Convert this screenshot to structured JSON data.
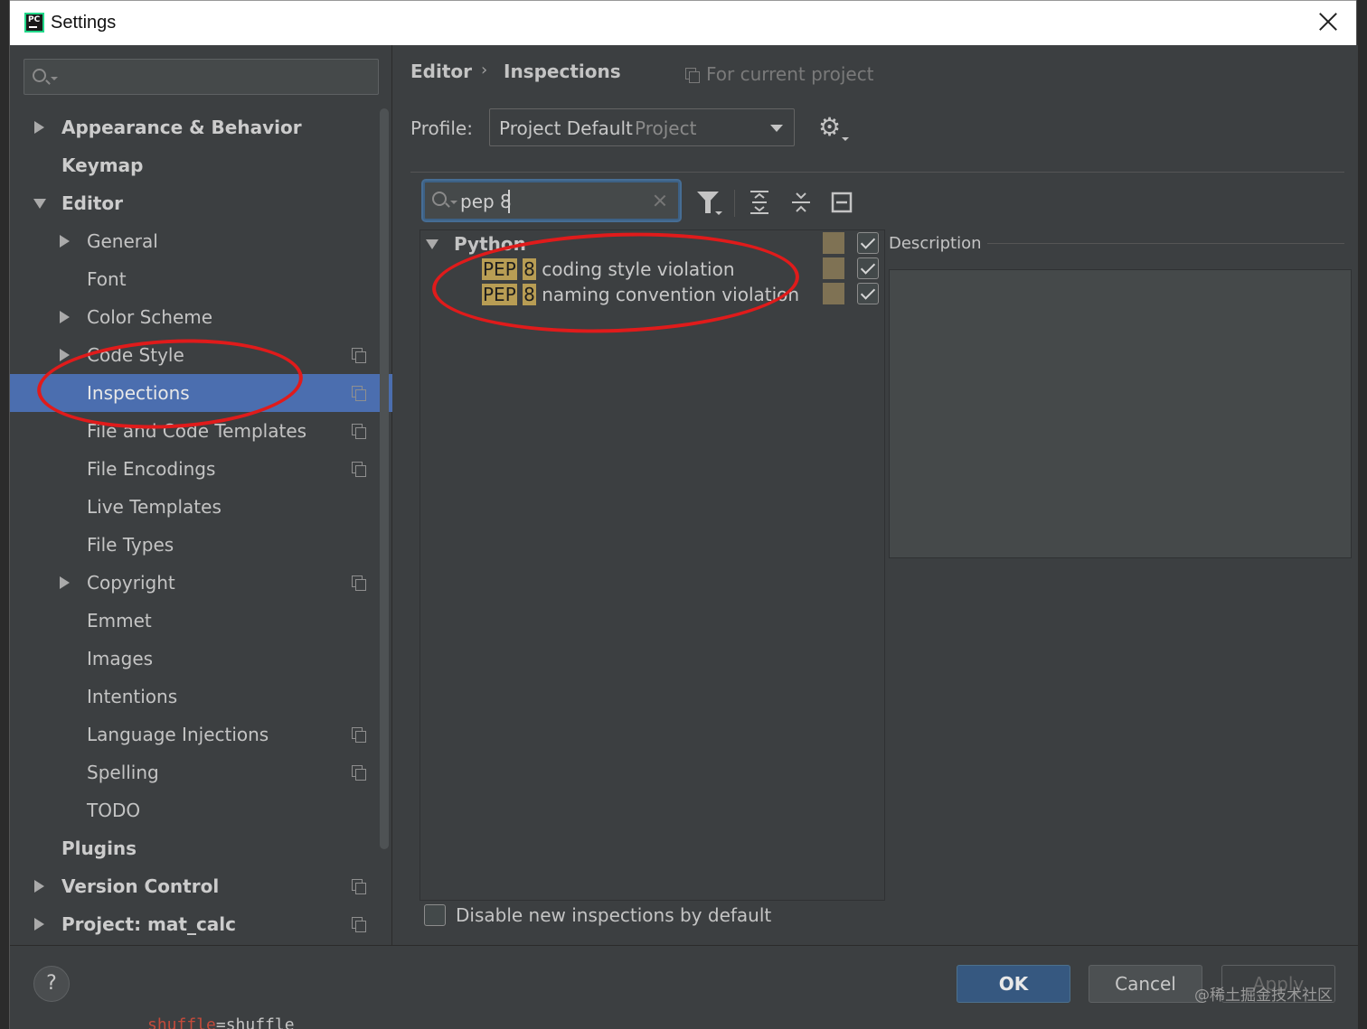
{
  "window": {
    "title": "Settings"
  },
  "search": {
    "placeholder": ""
  },
  "sidebar": {
    "items": [
      {
        "label": "Appearance & Behavior"
      },
      {
        "label": "Keymap"
      },
      {
        "label": "Editor"
      },
      {
        "label": "General"
      },
      {
        "label": "Font"
      },
      {
        "label": "Color Scheme"
      },
      {
        "label": "Code Style"
      },
      {
        "label": "Inspections"
      },
      {
        "label": "File and Code Templates"
      },
      {
        "label": "File Encodings"
      },
      {
        "label": "Live Templates"
      },
      {
        "label": "File Types"
      },
      {
        "label": "Copyright"
      },
      {
        "label": "Emmet"
      },
      {
        "label": "Images"
      },
      {
        "label": "Intentions"
      },
      {
        "label": "Language Injections"
      },
      {
        "label": "Spelling"
      },
      {
        "label": "TODO"
      },
      {
        "label": "Plugins"
      },
      {
        "label": "Version Control"
      },
      {
        "label": "Project: mat_calc"
      }
    ],
    "selected": "Inspections"
  },
  "breadcrumb": {
    "parent": "Editor",
    "separator": "›",
    "current": "Inspections",
    "scope": "For current project"
  },
  "profile": {
    "label": "Profile:",
    "value": "Project Default",
    "scope": "Project"
  },
  "inspection_search": {
    "value": "pep 8"
  },
  "inspection_tree": {
    "group": "Python",
    "items": [
      {
        "hl1": "PEP",
        "hl2": "8",
        "rest": " coding style violation",
        "checked": true
      },
      {
        "hl1": "PEP",
        "hl2": "8",
        "rest": " naming convention violation",
        "checked": true
      }
    ]
  },
  "description": {
    "label": "Description"
  },
  "options": {
    "disable_new": "Disable new inspections by default"
  },
  "buttons": {
    "help": "?",
    "ok": "OK",
    "cancel": "Cancel",
    "apply": "Apply"
  },
  "watermark": "@稀土掘金技术社区",
  "code_peek": {
    "name": "shuffle",
    "rest": "=shuffle"
  },
  "colors": {
    "selection": "#4b6eaf",
    "ok_button": "#365880",
    "highlight": "#b89d54",
    "annotation": "#e01b1b"
  }
}
